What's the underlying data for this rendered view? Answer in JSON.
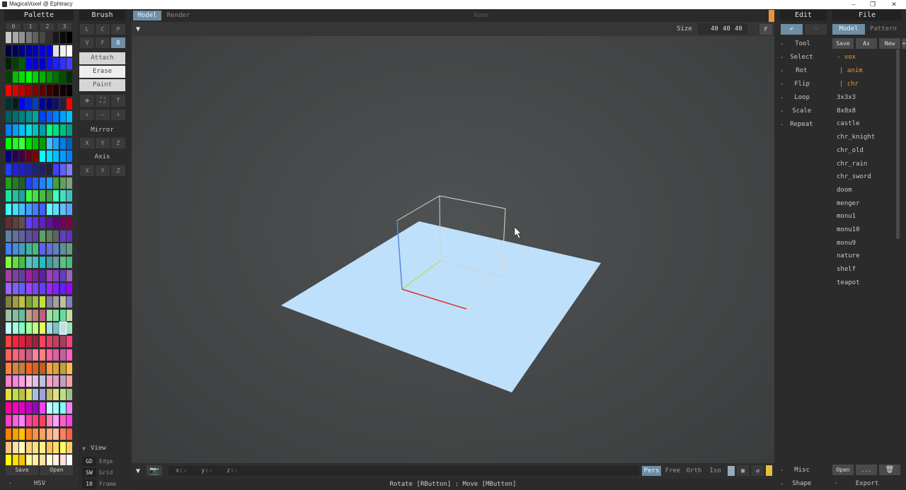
{
  "window": {
    "title": "MagicaVoxel @ Ephtracy",
    "minimize": "–",
    "maximize": "❐",
    "close": "✕"
  },
  "palette": {
    "title": "Palette",
    "tabs": [
      "0",
      "1",
      "2",
      "3"
    ],
    "save_label": "Save",
    "open_label": "Open",
    "mode_label": "HSV",
    "rows": [
      [
        "#c8c8c8",
        "#a8a8a8",
        "#909090",
        "#787878",
        "#606060",
        "#484848",
        "#303030",
        "#181818",
        "#0a0a0a",
        "#000000"
      ],
      [
        "#000040",
        "#000060",
        "#000080",
        "#0000a0",
        "#0000c0",
        "#0000e0",
        "#0000ff",
        "#e0e0e0",
        "#f0f0f0",
        "#ffffff"
      ],
      [
        "#002000",
        "#004000",
        "#006000",
        "#0000ff",
        "#0000e0",
        "#0000c0",
        "#1010ff",
        "#2020ff",
        "#3030ff",
        "#4040ff"
      ],
      [
        "#004000",
        "#00c000",
        "#00e000",
        "#00ff00",
        "#00d000",
        "#00b000",
        "#009000",
        "#007000",
        "#005000",
        "#003000"
      ],
      [
        "#ff0000",
        "#e00000",
        "#c00000",
        "#a00000",
        "#800000",
        "#600000",
        "#400000",
        "#200000",
        "#100000",
        "#080000"
      ],
      [
        "#003030",
        "#002020",
        "#0000ff",
        "#0020e0",
        "#0040c0",
        "#0000a0",
        "#000080",
        "#101060",
        "#202040",
        "#ff0000"
      ],
      [
        "#006060",
        "#007070",
        "#008080",
        "#009090",
        "#00a0a0",
        "#0040ff",
        "#0060ff",
        "#0080ff",
        "#00a0ff",
        "#00c0ff"
      ],
      [
        "#0080ff",
        "#00a0ff",
        "#00c0ff",
        "#00e0e0",
        "#00c0c0",
        "#00a0a0",
        "#00ff80",
        "#00e080",
        "#00c080",
        "#00a080"
      ],
      [
        "#00ff00",
        "#20ff20",
        "#40ff40",
        "#00e000",
        "#00c000",
        "#00a000",
        "#40c0ff",
        "#20a0ff",
        "#0080e0",
        "#0060c0"
      ],
      [
        "#000080",
        "#200060",
        "#400040",
        "#600020",
        "#800000",
        "#00ffff",
        "#00e0ff",
        "#00c0ff",
        "#00a0ff",
        "#0080ff"
      ],
      [
        "#2040ff",
        "#2020e0",
        "#2020c0",
        "#2020a0",
        "#202080",
        "#202060",
        "#202040",
        "#4040ff",
        "#6060ff",
        "#8080ff"
      ],
      [
        "#20a020",
        "#208020",
        "#206020",
        "#2040ff",
        "#2060ff",
        "#2080ff",
        "#20a0ff",
        "#40a040",
        "#60a060",
        "#80a080"
      ],
      [
        "#20e0a0",
        "#20c0a0",
        "#20a0a0",
        "#40ff40",
        "#40e040",
        "#40c040",
        "#40a040",
        "#40ffc0",
        "#40e0c0",
        "#40c0c0"
      ],
      [
        "#40ffff",
        "#40e0ff",
        "#40c0ff",
        "#40a0ff",
        "#4080ff",
        "#4060ff",
        "#60ffff",
        "#60e0ff",
        "#60c0ff",
        "#60a0ff"
      ],
      [
        "#603030",
        "#604040",
        "#605050",
        "#6040ff",
        "#6030e0",
        "#6020c0",
        "#6010a0",
        "#600080",
        "#700060",
        "#800040"
      ],
      [
        "#6080a0",
        "#6070a0",
        "#6060a0",
        "#6050a0",
        "#6040a0",
        "#60a060",
        "#608060",
        "#606060",
        "#6040c0",
        "#6030c0"
      ],
      [
        "#4080ff",
        "#4090e0",
        "#40a0c0",
        "#40b0a0",
        "#40c080",
        "#6060ff",
        "#6070e0",
        "#6080c0",
        "#6090a0",
        "#60a080"
      ],
      [
        "#80ff40",
        "#60e040",
        "#40c040",
        "#60c0c0",
        "#40c0c0",
        "#20c0c0",
        "#40a0a0",
        "#60a0a0",
        "#60c080",
        "#40c080"
      ],
      [
        "#a040a0",
        "#8040a0",
        "#6040a0",
        "#a020a0",
        "#8020a0",
        "#6020a0",
        "#a040c0",
        "#8040c0",
        "#6040c0",
        "#a060c0"
      ],
      [
        "#a060ff",
        "#8060ff",
        "#6060ff",
        "#a040ff",
        "#8040ff",
        "#6040ff",
        "#a020ff",
        "#8020ff",
        "#6020ff",
        "#a000ff"
      ],
      [
        "#808040",
        "#a0a040",
        "#c0c040",
        "#80a040",
        "#a0c040",
        "#c0e040",
        "#8080a0",
        "#a0a0a0",
        "#c0c0a0",
        "#8080c0"
      ],
      [
        "#a0c0a0",
        "#80c0a0",
        "#60c0a0",
        "#c0a080",
        "#c08080",
        "#c06080",
        "#a0e0a0",
        "#80e0a0",
        "#60e0a0",
        "#c0e0a0"
      ],
      [
        "#c0ffff",
        "#a0ffe0",
        "#80ffc0",
        "#a0ffa0",
        "#c0ff80",
        "#e0ff60",
        "#a0e0e0",
        "#80c0c0",
        "#c0e0e0",
        "#a0e0c0"
      ],
      [
        "#ff4040",
        "#ff2040",
        "#e02040",
        "#c02040",
        "#a02040",
        "#ff4060",
        "#e04060",
        "#c04060",
        "#a04060",
        "#ff4080"
      ],
      [
        "#ff6060",
        "#ff6080",
        "#e06080",
        "#c06080",
        "#ff80a0",
        "#ff8080",
        "#ff60a0",
        "#e060a0",
        "#c060a0",
        "#ff60c0"
      ],
      [
        "#ff8040",
        "#e08040",
        "#c08040",
        "#ff6020",
        "#e06020",
        "#c06020",
        "#ffa040",
        "#e0a040",
        "#c0a040",
        "#ffc040"
      ],
      [
        "#ff80c0",
        "#ff80e0",
        "#ffa0e0",
        "#ffc0e0",
        "#e0c0e0",
        "#c0c0e0",
        "#ffa0c0",
        "#e0a0c0",
        "#c0a0c0",
        "#ffa0a0"
      ],
      [
        "#e0e040",
        "#c0e040",
        "#c0c040",
        "#e0e060",
        "#a0c0e0",
        "#a0a0e0",
        "#c0c060",
        "#e0e080",
        "#c0e080",
        "#a0c080"
      ],
      [
        "#ff00a0",
        "#ff00c0",
        "#e000c0",
        "#c000c0",
        "#a000c0",
        "#ff40ff",
        "#c0ffff",
        "#a0ffff",
        "#80ffff",
        "#ff80ff"
      ],
      [
        "#ff40c0",
        "#ff60e0",
        "#ff80ff",
        "#ff40a0",
        "#ff4080",
        "#ff4060",
        "#ff80c0",
        "#ffa0ff",
        "#ff60c0",
        "#ff40e0"
      ],
      [
        "#ff8000",
        "#ffa000",
        "#ffc000",
        "#ff8020",
        "#ff9040",
        "#ffa060",
        "#ffb080",
        "#ffc0a0",
        "#ff8060",
        "#ff6040"
      ],
      [
        "#ffc080",
        "#ffe0a0",
        "#ffffc0",
        "#ffd080",
        "#ffe080",
        "#fff080",
        "#ffc060",
        "#ffe060",
        "#ffff60",
        "#ffd060"
      ],
      [
        "#ffff00",
        "#ffe000",
        "#ffc000",
        "#ffffa0",
        "#fff0a0",
        "#ffe0a0",
        "#ffffe0",
        "#fff0e0",
        "#ffe0e0",
        "#ffffff"
      ]
    ]
  },
  "brush": {
    "title": "Brush",
    "row1": [
      "L",
      "C",
      "P"
    ],
    "row2": [
      "V",
      "F",
      "B"
    ],
    "attach": "Attach",
    "erase": "Erase",
    "paint": "Paint",
    "tools": [
      "✥",
      "⛶",
      "⤒"
    ],
    "tools2": [
      "‹",
      "–",
      "›"
    ],
    "mirror_label": "Mirror",
    "mirror": [
      "X",
      "Y",
      "Z"
    ],
    "axis_label": "Axis",
    "axis": [
      "X",
      "Y",
      "Z"
    ],
    "view_label": "View",
    "view_items": [
      {
        "key": "GD",
        "label": "Edge"
      },
      {
        "key": "SW",
        "label": "Grid"
      },
      {
        "key": "10",
        "label": "Frame"
      }
    ]
  },
  "topbar": {
    "model_tab": "Model",
    "render_tab": "Render",
    "name_placeholder": "Name"
  },
  "sizebar": {
    "label": "Size",
    "x": "40",
    "y": "40",
    "z": "40",
    "f": "F"
  },
  "bottombar": {
    "x": "x:-",
    "y": "y:-",
    "z": "z:-",
    "modes": [
      "Pers",
      "Free",
      "Orth",
      "Iso"
    ]
  },
  "status": "Rotate [RButton] : Move [MButton]",
  "edit": {
    "title": "Edit",
    "items": [
      "Tool",
      "Select",
      "Rot",
      "Flip",
      "Loop",
      "Scale",
      "Repeat"
    ],
    "misc": "Misc",
    "shape": "Shape"
  },
  "file": {
    "title": "File",
    "tab_model": "Model",
    "tab_pattern": "Pattern",
    "save": "Save",
    "as": "As",
    "new": "New",
    "plus": "+",
    "folders": [
      "- vox",
      "| anim",
      "| chr"
    ],
    "files": [
      "3x3x3",
      "8x8x8",
      "castle",
      "chr_knight",
      "chr_old",
      "chr_rain",
      "chr_sword",
      "doom",
      "menger",
      "monu1",
      "monu10",
      "monu9",
      "nature",
      "shelf",
      "teapot"
    ],
    "open": "Open",
    "more": "...",
    "export": "Export"
  },
  "colors": {
    "accent": "#6e8ea6",
    "ground": "#bfe0fa",
    "orange": "#e8953c"
  }
}
